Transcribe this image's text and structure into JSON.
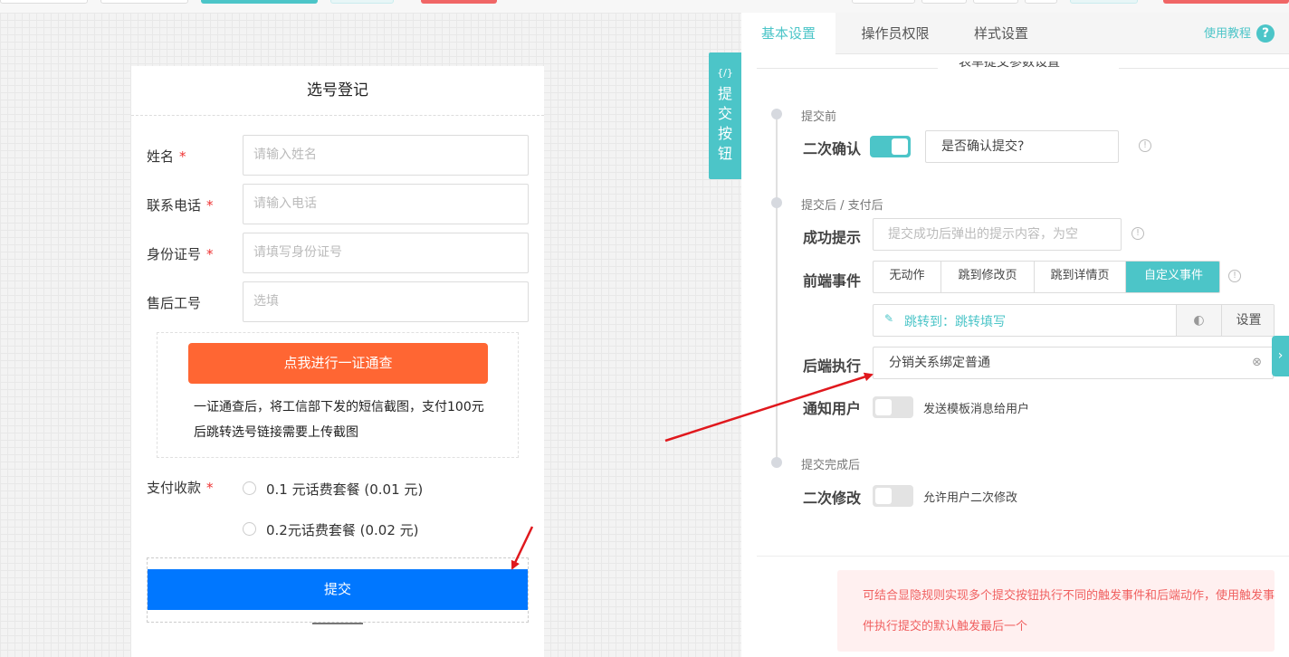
{
  "form": {
    "title": "选号登记",
    "fields": [
      {
        "label": "姓名",
        "required": "*",
        "placeholder": "请输入姓名"
      },
      {
        "label": "联系电话",
        "required": "*",
        "placeholder": "请输入电话"
      },
      {
        "label": "身份证号",
        "required": "*",
        "placeholder": "请填写身份证号"
      },
      {
        "label": "售后工号",
        "required": "",
        "placeholder": "选填"
      }
    ],
    "promo_button": "点我进行一证通查",
    "promo_text": "一证通查后，将工信部下发的短信截图，支付100元后跳转选号链接需要上传截图",
    "payment": {
      "label": "支付收款",
      "required": "*",
      "options": [
        "0.1 元话费套餐 (0.01 元)",
        "0.2元话费套餐 (0.02 元)"
      ]
    },
    "submit_label": "提交"
  },
  "vtab": {
    "code": "{/}",
    "label": "提交按钮"
  },
  "panel": {
    "tabs": [
      "基本设置",
      "操作员权限",
      "样式设置"
    ],
    "active_tab": "基本设置",
    "help_link": "使用教程",
    "section_title": "表单提交参数设置",
    "stages": [
      "提交前",
      "提交后 / 支付后",
      "提交完成后"
    ],
    "confirm": {
      "label": "二次确认",
      "value": "是否确认提交?"
    },
    "success": {
      "label": "成功提示",
      "placeholder": "提交成功后弹出的提示内容，为空"
    },
    "front_event": {
      "label": "前端事件",
      "options": [
        "无动作",
        "跳到修改页",
        "跳到详情页",
        "自定义事件"
      ],
      "active": "自定义事件",
      "jump_text": "跳转到：跳转填写",
      "settings": "设置"
    },
    "backend": {
      "label": "后端执行",
      "value": "分销关系绑定普通"
    },
    "notify": {
      "label": "通知用户",
      "text": "发送模板消息给用户"
    },
    "modify": {
      "label": "二次修改",
      "text": "允许用户二次修改"
    },
    "note": "可结合显隐规则实现多个提交按钮执行不同的触发事件和后端动作，使用触发事件执行提交的默认触发最后一个"
  },
  "colors": {
    "accent": "#4cc5c8",
    "submit": "#0077ff",
    "promo": "#ff6633",
    "arrow": "#e0181d"
  }
}
